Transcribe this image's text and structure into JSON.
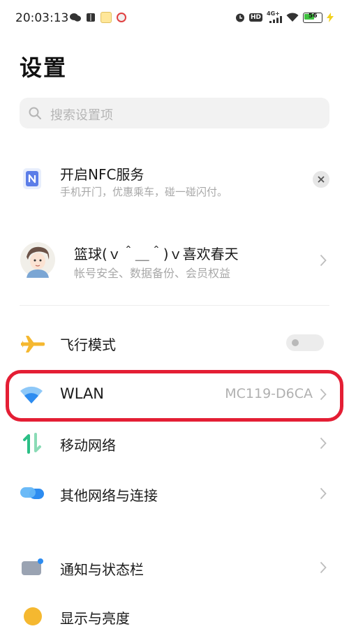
{
  "status_bar": {
    "time": "20:03:13",
    "icons_left": [
      "wechat-icon",
      "book-icon",
      "yellow-app-icon",
      "red-app-icon"
    ],
    "icons_right": [
      "alarm-icon",
      "hd-icon",
      "signal-4g-icon",
      "wifi-icon",
      "battery-icon",
      "charging-icon"
    ],
    "hd_label": "HD",
    "network_label": "4G+",
    "battery_level": "56"
  },
  "page": {
    "title": "设置"
  },
  "search": {
    "placeholder": "搜索设置项"
  },
  "nfc_card": {
    "title": "开启NFC服务",
    "subtitle": "手机开门，优惠乘车，碰一碰闪付。"
  },
  "account": {
    "name": "篮球(ｖ＾＿＾)ｖ喜欢春天",
    "subtitle": "帐号安全、数据备份、会员权益"
  },
  "settings": [
    {
      "label": "飞行模式",
      "icon": "airplane-icon",
      "toggle": false
    },
    {
      "label": "WLAN",
      "icon": "wifi-icon",
      "value": "MC119-D6CA",
      "highlighted": true
    },
    {
      "label": "移动网络",
      "icon": "mobile-data-icon"
    },
    {
      "label": "其他网络与连接",
      "icon": "connections-icon"
    },
    {
      "label": "通知与状态栏",
      "icon": "notification-icon"
    },
    {
      "label": "显示与亮度",
      "icon": "display-icon"
    }
  ],
  "colors": {
    "accent_blue": "#2d8cf0",
    "highlight_red": "#e41e34",
    "airplane_yellow": "#f5b830",
    "mobile_green": "#2bbf86"
  }
}
